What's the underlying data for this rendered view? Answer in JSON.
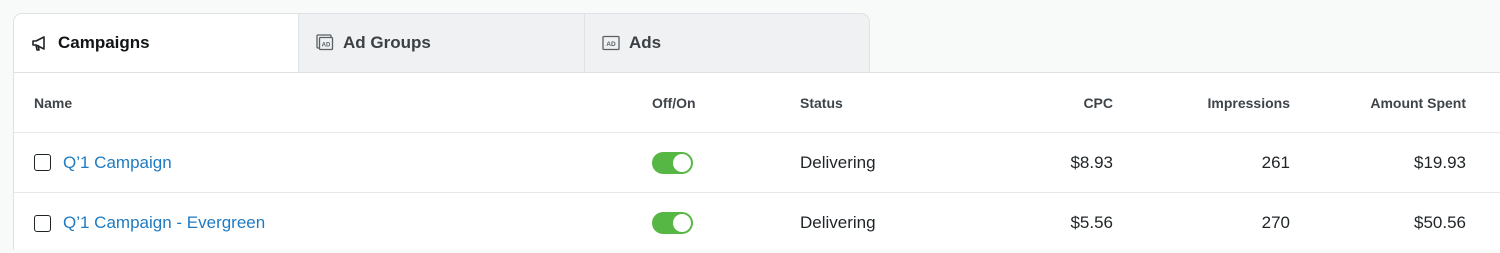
{
  "tabs": [
    {
      "label": "Campaigns",
      "icon": "megaphone-icon",
      "active": true
    },
    {
      "label": "Ad Groups",
      "icon": "ad-stack-icon",
      "active": false
    },
    {
      "label": "Ads",
      "icon": "ad-icon",
      "active": false
    }
  ],
  "table": {
    "headers": {
      "name": "Name",
      "off_on": "Off/On",
      "status": "Status",
      "cpc": "CPC",
      "impressions": "Impressions",
      "amount_spent": "Amount Spent"
    },
    "rows": [
      {
        "name": "Q’1 Campaign",
        "on": true,
        "status": "Delivering",
        "cpc": "$8.93",
        "impressions": "261",
        "amount_spent": "$19.93"
      },
      {
        "name": "Q’1 Campaign - Evergreen",
        "on": true,
        "status": "Delivering",
        "cpc": "$5.56",
        "impressions": "270",
        "amount_spent": "$50.56"
      }
    ]
  },
  "colors": {
    "link": "#1f7bc1",
    "toggle_on": "#57b745"
  }
}
